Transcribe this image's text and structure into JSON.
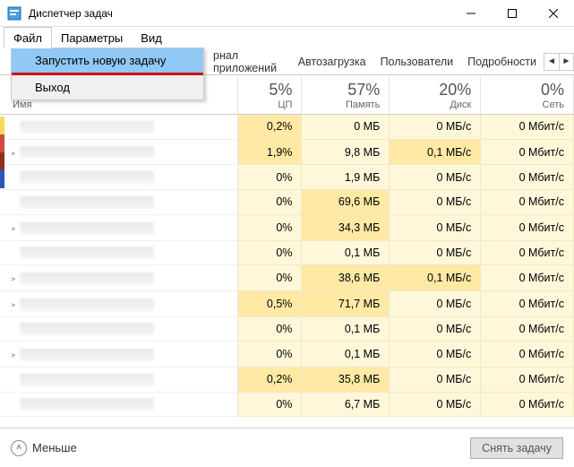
{
  "window": {
    "title": "Диспетчер задач"
  },
  "menubar": {
    "file": "Файл",
    "options": "Параметры",
    "view": "Вид"
  },
  "file_menu": {
    "run_new_task": "Запустить новую задачу",
    "exit": "Выход"
  },
  "tabs": {
    "history_partial": "рнал приложений",
    "startup": "Автозагрузка",
    "users": "Пользователи",
    "details": "Подробности"
  },
  "columns": {
    "name": "Имя",
    "cpu_pct": "5%",
    "cpu_label": "ЦП",
    "mem_pct": "57%",
    "mem_label": "Память",
    "disk_pct": "20%",
    "disk_label": "Диск",
    "net_pct": "0%",
    "net_label": "Сеть"
  },
  "rows": [
    {
      "expand": false,
      "cpu": "0,2%",
      "cpu_med": true,
      "mem": "0 МБ",
      "mem_med": false,
      "disk": "0 МБ/с",
      "disk_med": false,
      "net": "0 Мбит/с"
    },
    {
      "expand": true,
      "cpu": "1,9%",
      "cpu_med": true,
      "mem": "9,8 МБ",
      "mem_med": false,
      "disk": "0,1 МБ/с",
      "disk_med": true,
      "net": "0 Мбит/с"
    },
    {
      "expand": false,
      "cpu": "0%",
      "cpu_med": false,
      "mem": "1,9 МБ",
      "mem_med": false,
      "disk": "0 МБ/с",
      "disk_med": false,
      "net": "0 Мбит/с"
    },
    {
      "expand": false,
      "cpu": "0%",
      "cpu_med": false,
      "mem": "69,6 МБ",
      "mem_med": true,
      "disk": "0 МБ/с",
      "disk_med": false,
      "net": "0 Мбит/с"
    },
    {
      "expand": true,
      "cpu": "0%",
      "cpu_med": false,
      "mem": "34,3 МБ",
      "mem_med": true,
      "disk": "0 МБ/с",
      "disk_med": false,
      "net": "0 Мбит/с"
    },
    {
      "expand": false,
      "cpu": "0%",
      "cpu_med": false,
      "mem": "0,1 МБ",
      "mem_med": false,
      "disk": "0 МБ/с",
      "disk_med": false,
      "net": "0 Мбит/с"
    },
    {
      "expand": true,
      "cpu": "0%",
      "cpu_med": false,
      "mem": "38,6 МБ",
      "mem_med": true,
      "disk": "0,1 МБ/с",
      "disk_med": true,
      "net": "0 Мбит/с"
    },
    {
      "expand": true,
      "cpu": "0,5%",
      "cpu_med": true,
      "mem": "71,7 МБ",
      "mem_med": true,
      "disk": "0 МБ/с",
      "disk_med": false,
      "net": "0 Мбит/с"
    },
    {
      "expand": false,
      "cpu": "0%",
      "cpu_med": false,
      "mem": "0,1 МБ",
      "mem_med": false,
      "disk": "0 МБ/с",
      "disk_med": false,
      "net": "0 Мбит/с"
    },
    {
      "expand": true,
      "cpu": "0%",
      "cpu_med": false,
      "mem": "0,1 МБ",
      "mem_med": false,
      "disk": "0 МБ/с",
      "disk_med": false,
      "net": "0 Мбит/с"
    },
    {
      "expand": false,
      "cpu": "0,2%",
      "cpu_med": true,
      "mem": "35,8 МБ",
      "mem_med": true,
      "disk": "0 МБ/с",
      "disk_med": false,
      "net": "0 Мбит/с"
    },
    {
      "expand": false,
      "cpu": "0%",
      "cpu_med": false,
      "mem": "6,7 МБ",
      "mem_med": false,
      "disk": "0 МБ/с",
      "disk_med": false,
      "net": "0 Мбит/с"
    }
  ],
  "footer": {
    "fewer": "Меньше",
    "end_task": "Снять задачу"
  }
}
